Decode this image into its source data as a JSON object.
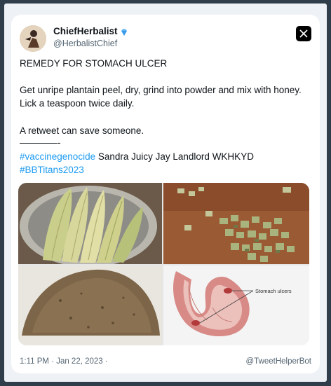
{
  "tweet": {
    "display_name": "ChiefHerbalist",
    "handle": "@HerbalistChief",
    "title_line": "REMEDY FOR STOMACH ULCER",
    "line1": "Get unripe plantain peel, dry, grind into powder and mix with honey.",
    "line2": "Lick a teaspoon twice daily.",
    "line3": "A retweet can save someone.",
    "divider": "————-",
    "hashtag1": "#vaccinegenocide",
    "line4_rest": " Sandra Juicy Jay Landlord WKHKYD",
    "hashtag2": "#BBTitans2023",
    "timestamp": "1:11 PM · Jan 22, 2023 ·",
    "watermark": "@TweetHelperBot"
  },
  "media": {
    "diagram_label": "Stomach ulcers"
  },
  "icons": [
    "verified-badge-icon",
    "x-logo-icon"
  ],
  "colors": {
    "accent": "#1d9bf0",
    "text": "#0f1419",
    "muted": "#536471",
    "frame": "#2f3e4a"
  }
}
